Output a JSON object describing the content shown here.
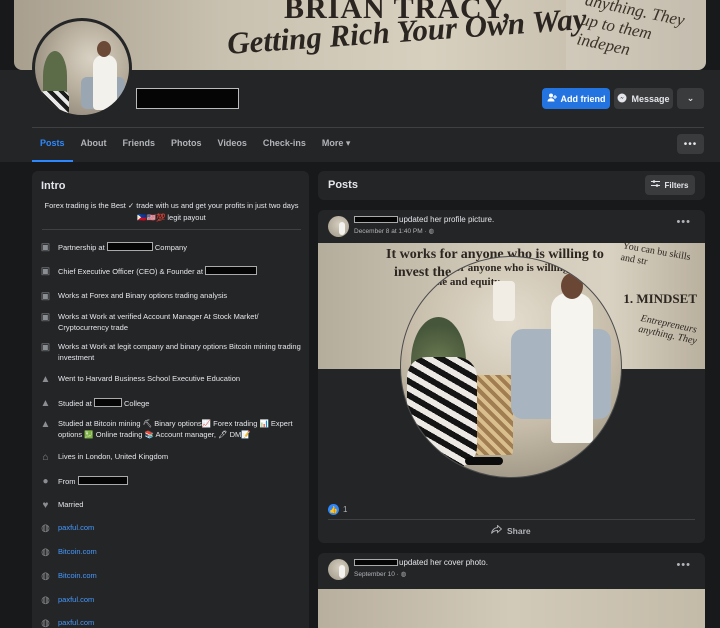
{
  "cover": {
    "line1": "BRIAN TRACY,",
    "line2": "Getting Rich Your Own Way",
    "side_text": "anything. They up to them indepen"
  },
  "profile": {
    "add_friend_label": "Add friend",
    "message_label": "Message",
    "more_label": "⌄"
  },
  "tabs": [
    {
      "label": "Posts"
    },
    {
      "label": "About"
    },
    {
      "label": "Friends"
    },
    {
      "label": "Photos"
    },
    {
      "label": "Videos"
    },
    {
      "label": "Check-ins"
    },
    {
      "label": "More ▾"
    }
  ],
  "tabs_more_button": "•••",
  "intro": {
    "title": "Intro",
    "bio": "Forex trading is the Best ✓ trade with us and get your profits in just two days🇵🇭🇺🇸💯 legit payout",
    "items": [
      {
        "icon": "briefcase-icon",
        "prefix": "Partnership at ",
        "suffix": " Company"
      },
      {
        "icon": "briefcase-icon",
        "prefix": "Chief Executive Officer (CEO) & Founder at ",
        "suffix": ""
      },
      {
        "icon": "briefcase-icon",
        "text": "Works at Forex and Binary options trading analysis"
      },
      {
        "icon": "briefcase-icon",
        "text": "Works at Work at verified Account Manager At Stock Market/ Cryptocurrency trade"
      },
      {
        "icon": "briefcase-icon",
        "text": "Works at Work at legit company and binary options Bitcoin mining trading investment"
      },
      {
        "icon": "graduation-cap-icon",
        "text": "Went to Harvard Business School Executive Education"
      },
      {
        "icon": "graduation-cap-icon",
        "prefix": "Studied at ",
        "suffix": " College"
      },
      {
        "icon": "graduation-cap-icon",
        "text": "Studied at Bitcoin mining ⛏ Binary options📈 Forex trading 📊 Expert options 💹 Online trading 📚 Account manager, 🖊 DM📝"
      },
      {
        "icon": "home-icon",
        "text": "Lives in London, United Kingdom"
      },
      {
        "icon": "location-pin-icon",
        "prefix": "From ",
        "suffix": ""
      },
      {
        "icon": "heart-icon",
        "text": "Married"
      },
      {
        "icon": "globe-icon",
        "link": "paxful.com"
      },
      {
        "icon": "globe-icon",
        "link": "Bitcoin.com"
      },
      {
        "icon": "globe-icon",
        "link": "Bitcoin.com"
      },
      {
        "icon": "globe-icon",
        "link": "paxful.com"
      },
      {
        "icon": "globe-icon",
        "link": "paxful.com"
      }
    ]
  },
  "posts": {
    "title": "Posts",
    "filters_label": "Filters",
    "items": [
      {
        "action": "updated her profile picture.",
        "date": "December 8 at 1:40 PM",
        "image_text1": "It works for anyone who is willing to",
        "image_text2": "invest the",
        "image_right": "You can bu skills and str",
        "image_right2": "1. MINDSET",
        "image_right3": "Entrepreneurs anything. They",
        "circle_text": "It works for anyone who is willing to invest the time and equity",
        "likes": "1",
        "share_label": "Share"
      },
      {
        "action": "updated her cover photo.",
        "date": "September 10"
      }
    ]
  },
  "colors": {
    "background": "#18191a",
    "card": "#242526",
    "accent": "#2d88ff",
    "primary_button": "#2374e1"
  }
}
